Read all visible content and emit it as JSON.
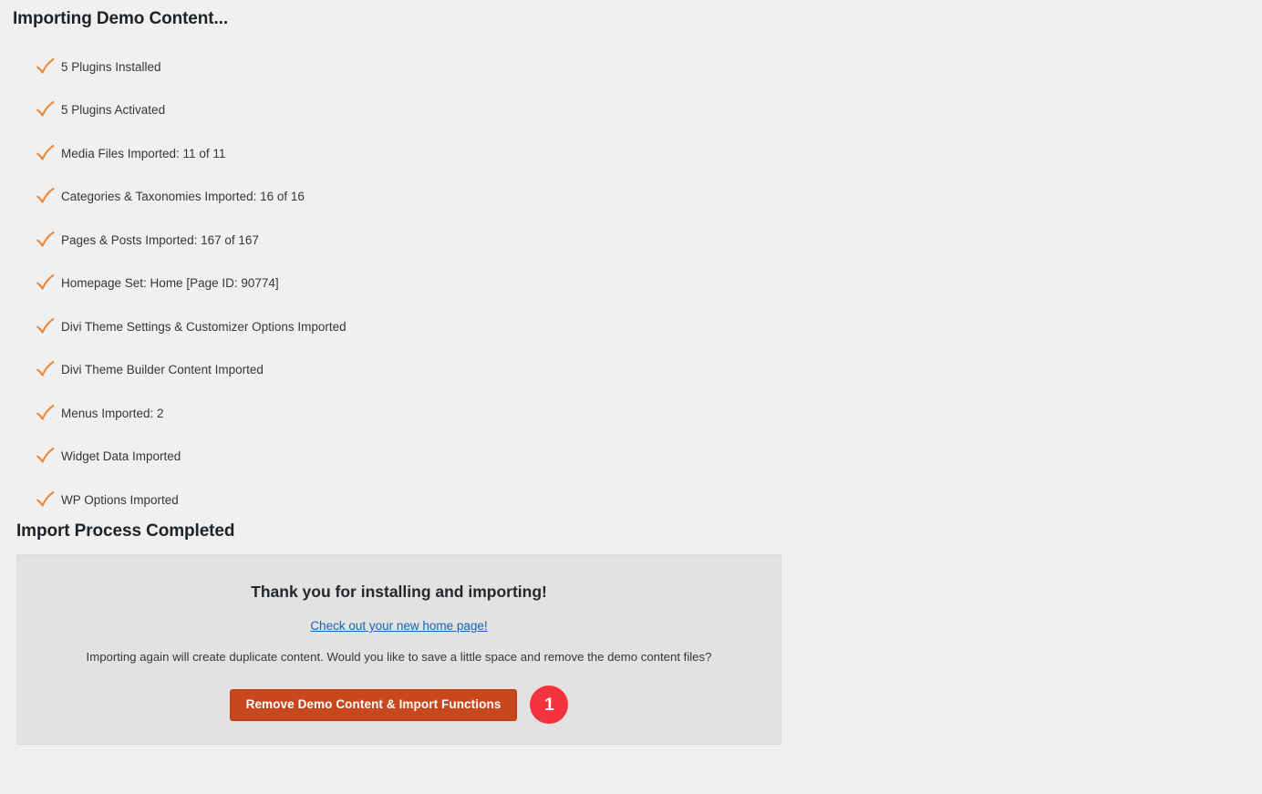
{
  "page": {
    "heading": "Importing Demo Content...",
    "completed_heading": "Import Process Completed",
    "background_color": "#f0f0f1"
  },
  "progress": {
    "check_icon": "orange-check-icon",
    "items": [
      {
        "label": "5 Plugins Installed"
      },
      {
        "label": "5 Plugins Activated"
      },
      {
        "label": "Media Files Imported: 11 of 11"
      },
      {
        "label": "Categories & Taxonomies Imported: 16 of 16"
      },
      {
        "label": "Pages & Posts Imported: 167 of 167"
      },
      {
        "label": "Homepage Set: Home [Page ID: 90774]"
      },
      {
        "label": "Divi Theme Settings & Customizer Options Imported"
      },
      {
        "label": "Divi Theme Builder Content Imported"
      },
      {
        "label": "Menus Imported: 2"
      },
      {
        "label": "Widget Data Imported"
      },
      {
        "label": "WP Options Imported"
      }
    ]
  },
  "completion_panel": {
    "background_color": "#e2e2e2",
    "thank_you": "Thank you for installing and importing!",
    "home_page_link": "Check out your new home page!",
    "link_color": "#1a62b8",
    "duplicate_note": "Importing again will create duplicate content. Would you like to save a little space and remove the demo content files?",
    "remove_button": {
      "label": "Remove Demo Content & Import Functions",
      "background_color": "#c9471e",
      "text_color": "#ffffff"
    },
    "step_badge": {
      "number": "1",
      "background_color": "#f5333f",
      "text_color": "#ffffff"
    }
  }
}
